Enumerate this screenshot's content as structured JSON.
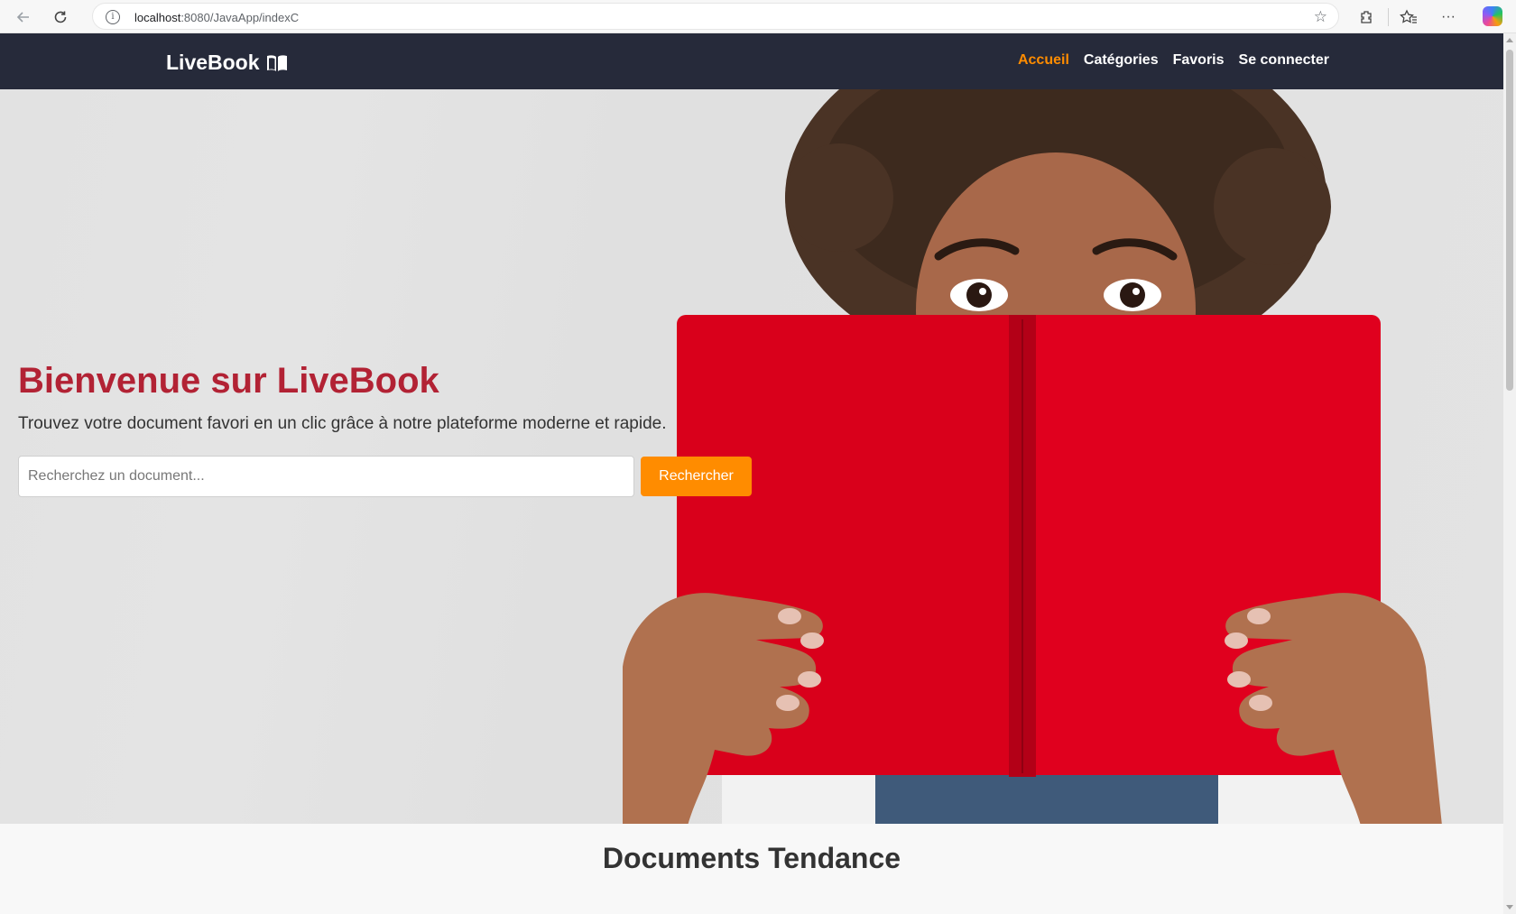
{
  "browser": {
    "url_host": "localhost",
    "url_path": ":8080/JavaApp/indexC",
    "icons": [
      "back-icon",
      "refresh-icon",
      "info-icon",
      "star-icon",
      "extensions-icon",
      "favorites-icon",
      "more-icon",
      "copilot-icon"
    ]
  },
  "navbar": {
    "brand": "LiveBook",
    "brand_icon": "book-open-icon",
    "links": [
      {
        "label": "Accueil",
        "active": true
      },
      {
        "label": "Catégories",
        "active": false
      },
      {
        "label": "Favoris",
        "active": false
      },
      {
        "label": "Se connecter",
        "active": false
      }
    ]
  },
  "hero": {
    "title": "Bienvenue sur LiveBook",
    "subtitle": "Trouvez votre document favori en un clic grâce à notre plateforme moderne et rapide.",
    "search_placeholder": "Recherchez un document...",
    "search_button": "Rechercher"
  },
  "section": {
    "title": "Documents Tendance"
  },
  "colors": {
    "navbar_bg": "#262a3a",
    "accent": "#ff8c00",
    "title": "#b22234",
    "book": "#d9001b"
  }
}
